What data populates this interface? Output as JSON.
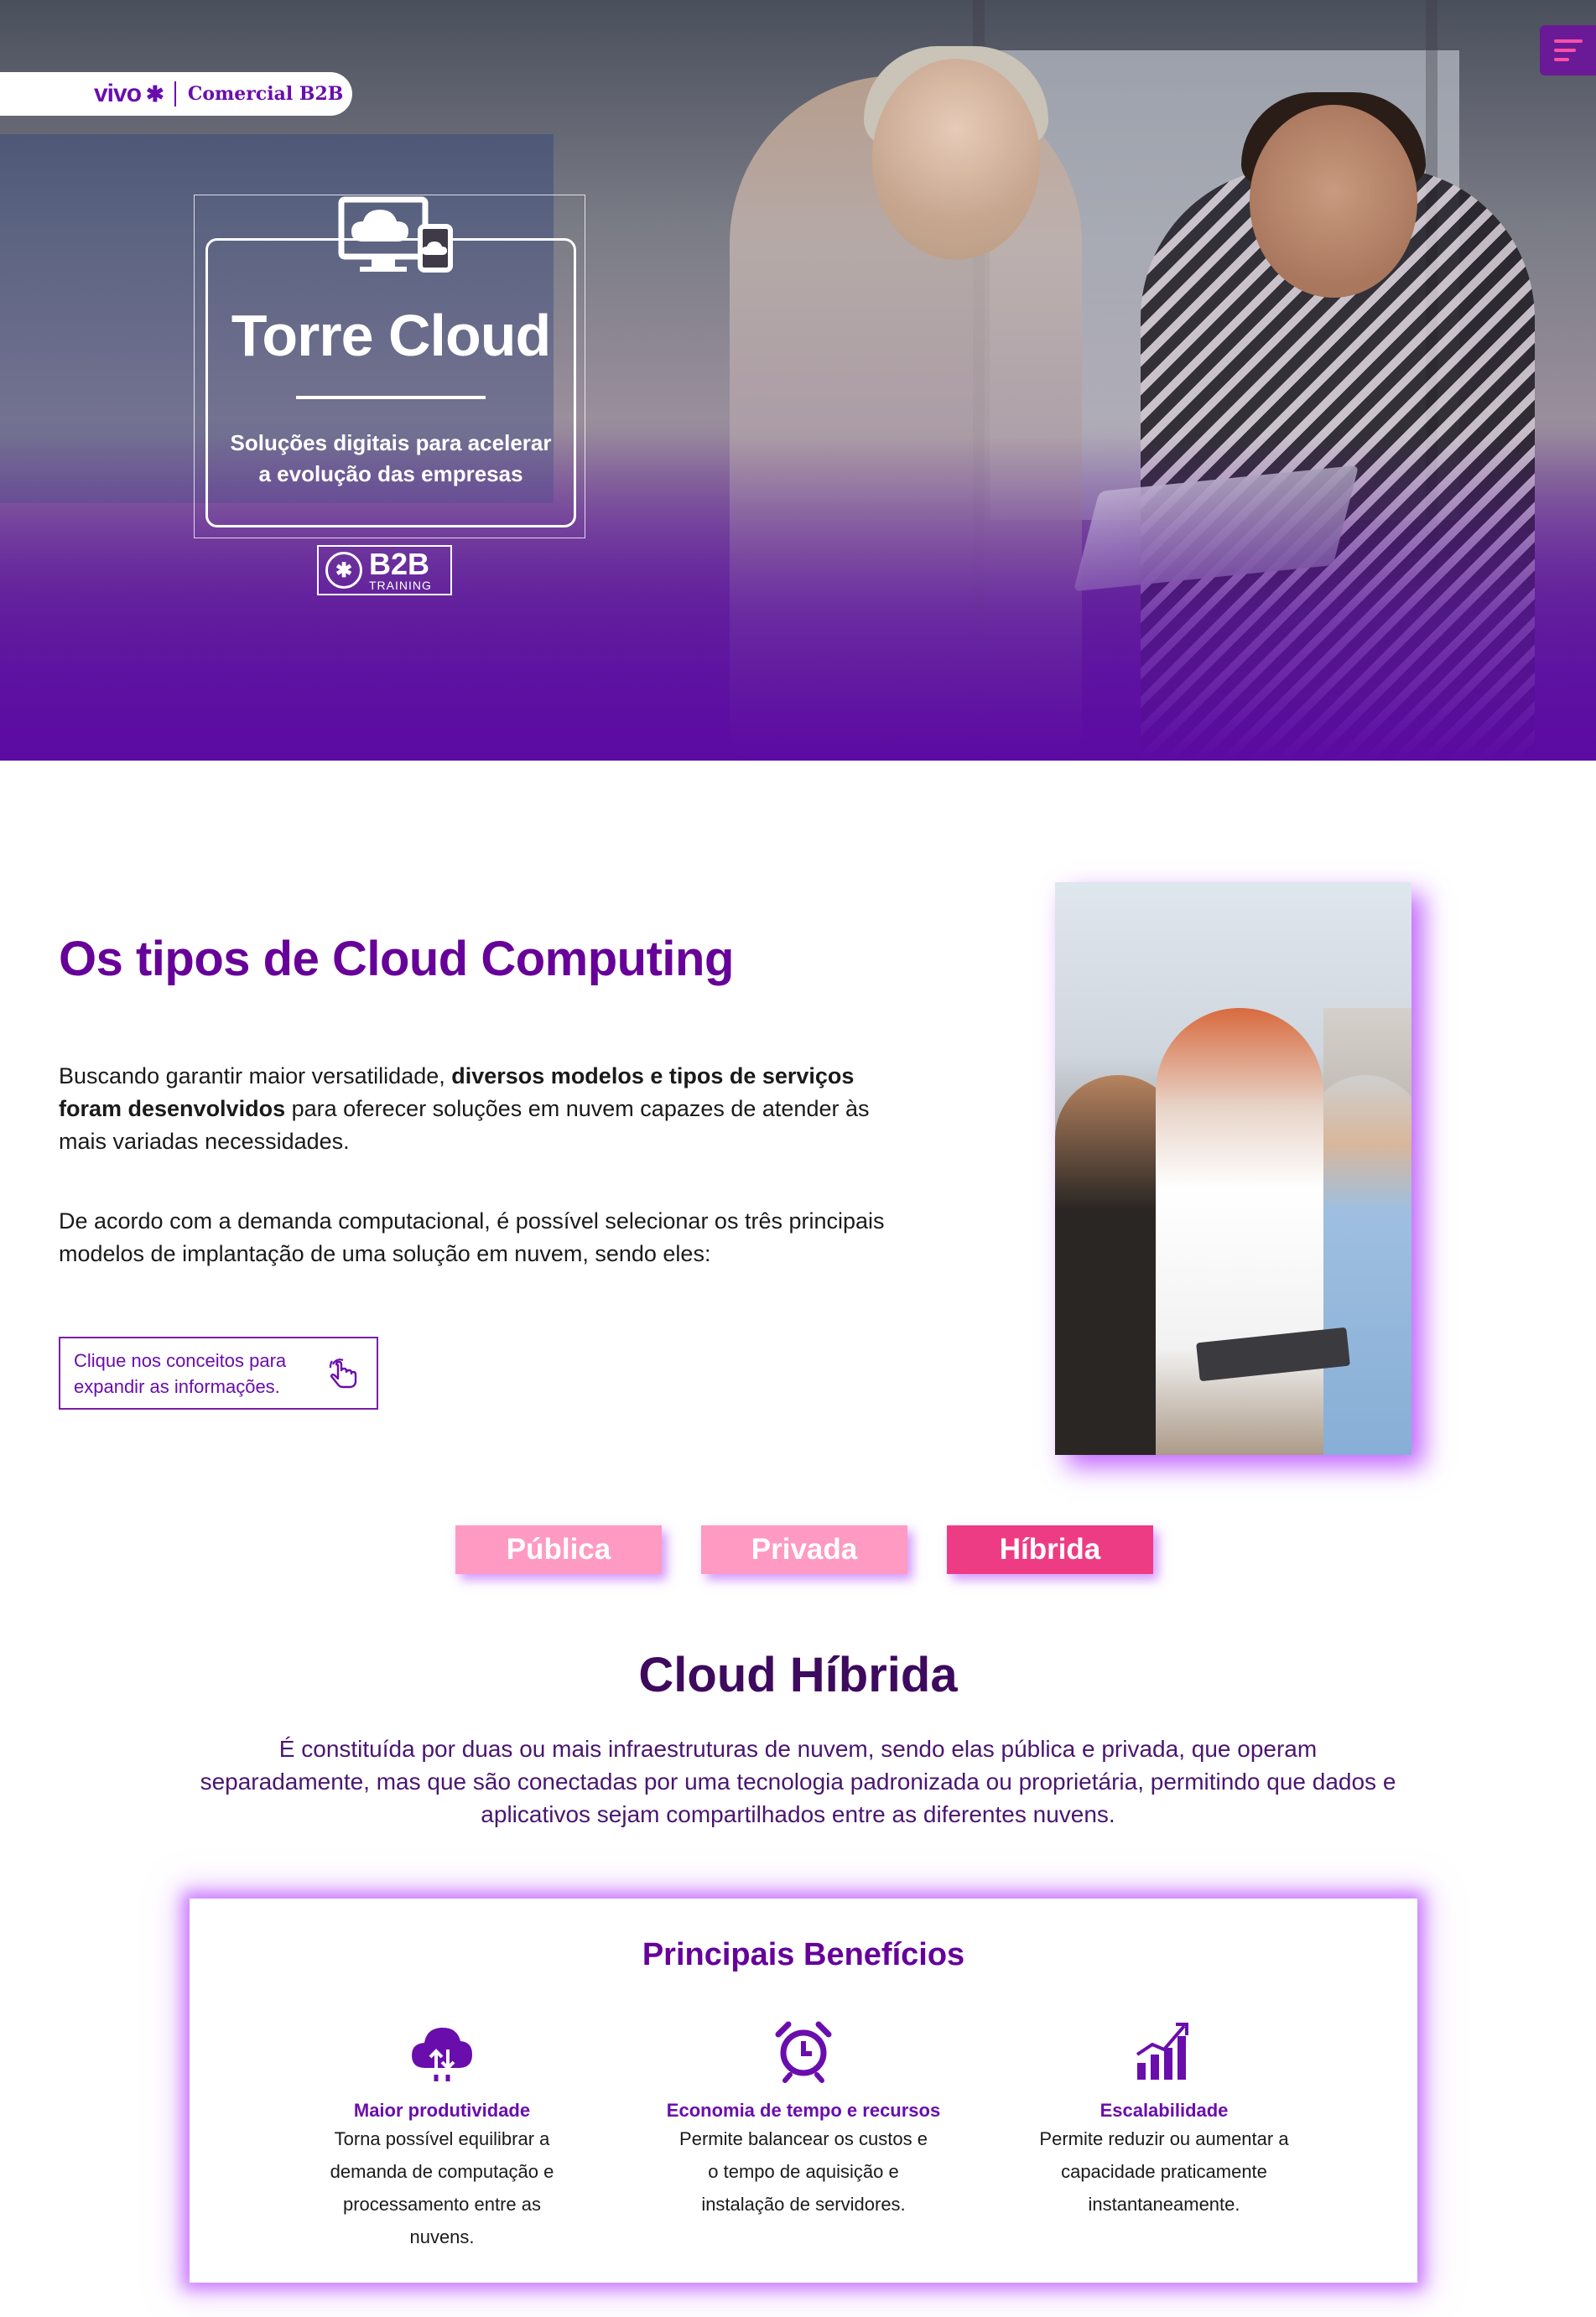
{
  "header": {
    "brand_vivo": "vivo",
    "brand_division": "Comercial B2B",
    "menu_icon": "hamburger-menu-icon"
  },
  "hero": {
    "title": "Torre Cloud",
    "subtitle_line1": "Soluções digitais para acelerar",
    "subtitle_line2": "a evolução das empresas",
    "badge_big": "B2B",
    "badge_small": "TRAINING",
    "icon": "cloud-devices-icon"
  },
  "intro": {
    "title": "Os tipos de Cloud Computing",
    "p1_a": "Buscando garantir maior versatilidade, ",
    "p1_b": "diversos modelos e tipos de serviços foram desenvolvidos",
    "p1_c": " para oferecer soluções em nuvem capazes de atender às mais variadas necessidades.",
    "p2": "De acordo com a demanda computacional, é possível selecionar os três principais modelos de implantação de uma solução em nuvem, sendo eles:",
    "hint": "Clique nos conceitos para expandir as informações.",
    "hint_icon": "tap-hand-icon"
  },
  "tabs": [
    {
      "label": "Pública",
      "active": false
    },
    {
      "label": "Privada",
      "active": false
    },
    {
      "label": "Híbrida",
      "active": true
    }
  ],
  "colors": {
    "primary": "#660099",
    "tab_inactive": "#ff9ac2",
    "tab_active": "#ee3c84",
    "menu_accent": "#ff4fa8"
  },
  "section": {
    "title": "Cloud Híbrida",
    "description": "É constituída por duas ou mais infraestruturas de nuvem, sendo elas pública e privada, que operam separadamente, mas que são conectadas por uma tecnologia padronizada ou proprietária, permitindo que dados e aplicativos sejam compartilhados entre as diferentes nuvens."
  },
  "benefits": {
    "title": "Principais Benefícios",
    "items": [
      {
        "icon": "cloud-transfer-icon",
        "name": "Maior produtividade",
        "l1": "Torna possível equilibrar a",
        "l2": "demanda de computação e",
        "l3": "processamento entre as",
        "l4": "nuvens."
      },
      {
        "icon": "alarm-clock-icon",
        "name": "Economia de tempo e recursos",
        "l1": "Permite balancear os custos e",
        "l2": "o tempo de aquisição e",
        "l3": "instalação de servidores.",
        "l4": ""
      },
      {
        "icon": "growth-chart-icon",
        "name": "Escalabilidade",
        "l1": "Permite reduzir ou aumentar a",
        "l2": "capacidade praticamente",
        "l3": "instantaneamente.",
        "l4": ""
      }
    ]
  }
}
